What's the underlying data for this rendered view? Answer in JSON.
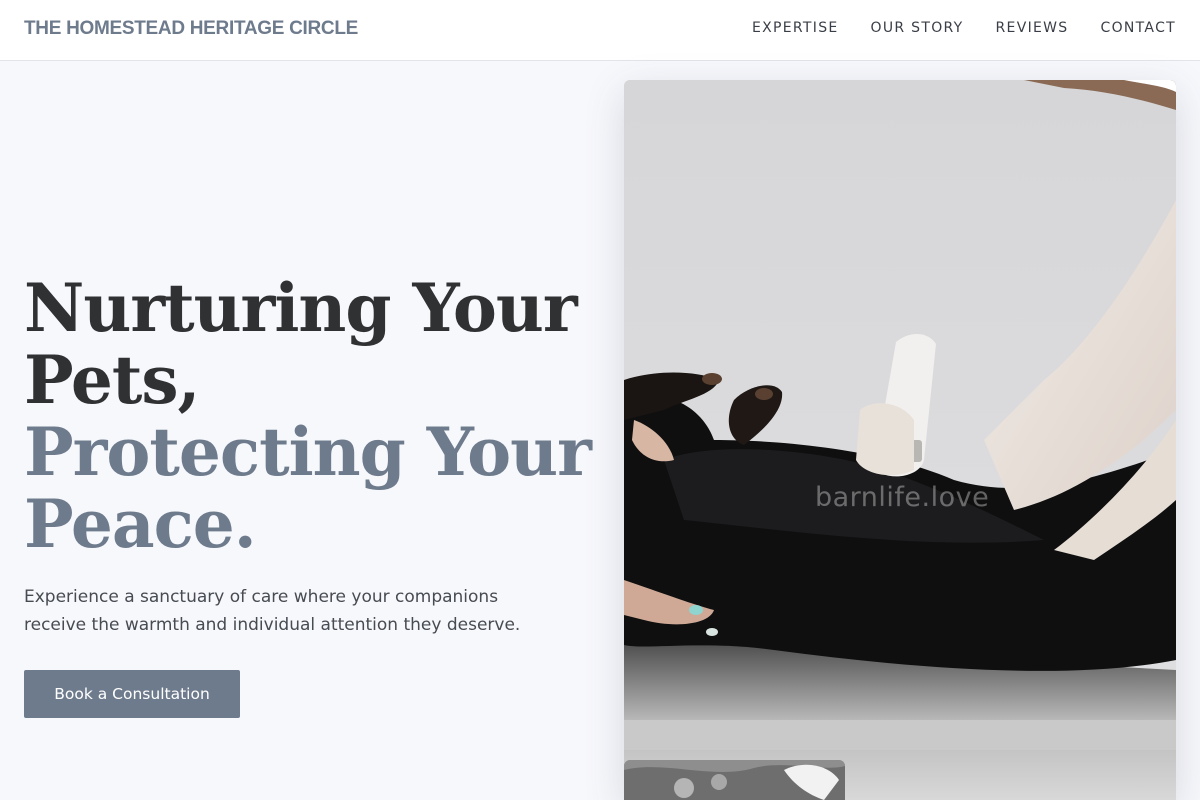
{
  "header": {
    "brand": "THE HOMESTEAD HERITAGE CIRCLE",
    "nav": [
      {
        "label": "EXPERTISE"
      },
      {
        "label": "OUR STORY"
      },
      {
        "label": "REVIEWS"
      },
      {
        "label": "CONTACT"
      }
    ]
  },
  "hero": {
    "headline_line1": "Nurturing Your Pets,",
    "headline_line2": "Protecting Your Peace.",
    "subtext": "Experience a sanctuary of care where your companions receive the warmth and individual attention they deserve.",
    "cta_label": "Book a Consultation"
  },
  "images": {
    "main_watermark": "barnlife.love"
  },
  "colors": {
    "accent": "#6e7b8d",
    "heading_dark": "#2f3133",
    "page_background": "#f7f8fc"
  }
}
